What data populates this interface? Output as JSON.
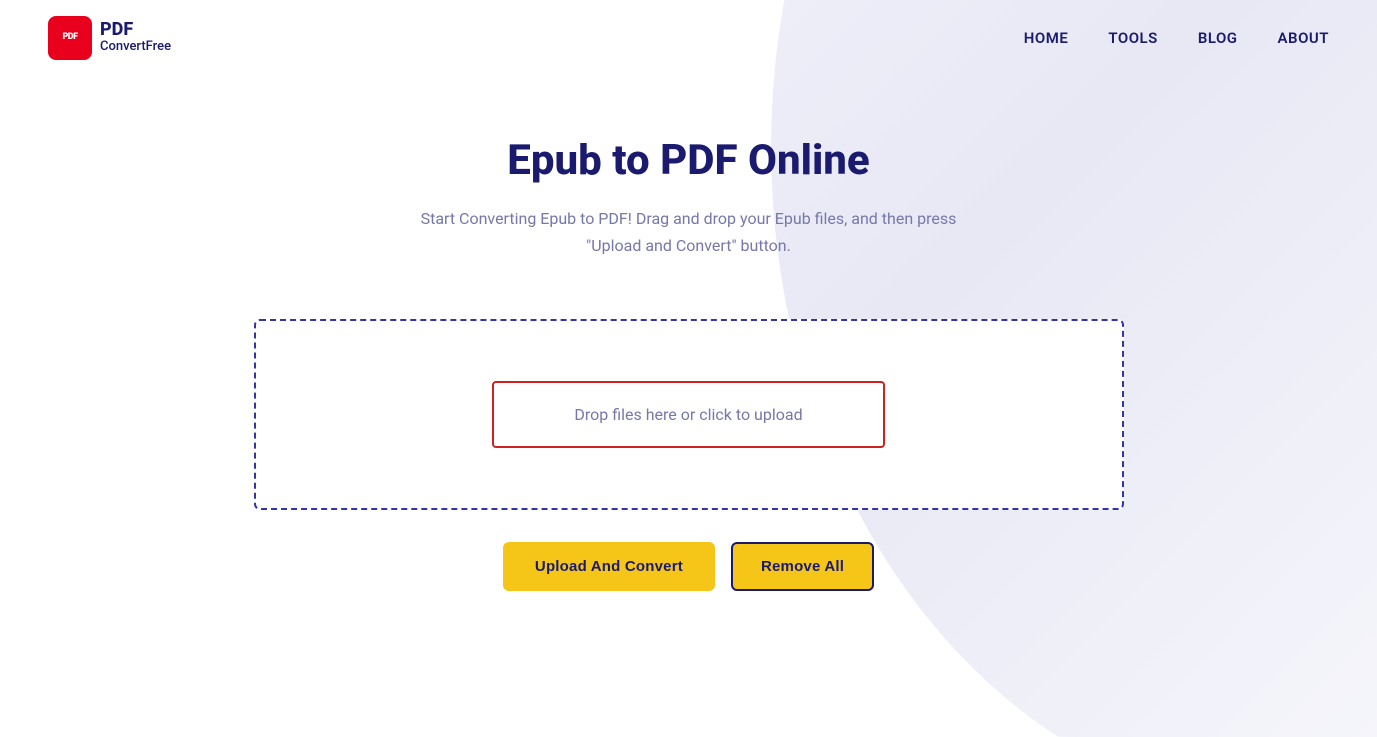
{
  "header": {
    "logo": {
      "icon_text": "PDF",
      "brand_name": "PDF",
      "brand_sub": "ConvertFree"
    },
    "nav": {
      "items": [
        {
          "id": "home",
          "label": "HOME"
        },
        {
          "id": "tools",
          "label": "TOOLS"
        },
        {
          "id": "blog",
          "label": "BLOG"
        },
        {
          "id": "about",
          "label": "ABOUT"
        }
      ]
    }
  },
  "main": {
    "title": "Epub to PDF Online",
    "subtitle": "Start Converting Epub to PDF! Drag and drop your Epub files, and then press \"Upload and Convert\" button.",
    "dropzone": {
      "label": "Drop files here or click to upload"
    },
    "buttons": {
      "upload": "Upload And Convert",
      "remove": "Remove All"
    }
  }
}
